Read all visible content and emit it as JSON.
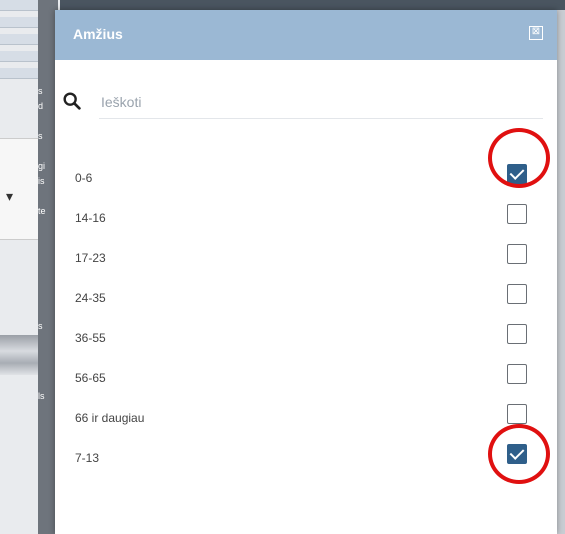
{
  "dialog": {
    "title": "Amžius",
    "search_placeholder": "Ieškoti"
  },
  "options": [
    {
      "label": "0-6",
      "checked": true
    },
    {
      "label": "14-16",
      "checked": false
    },
    {
      "label": "17-23",
      "checked": false
    },
    {
      "label": "24-35",
      "checked": false
    },
    {
      "label": "36-55",
      "checked": false
    },
    {
      "label": "56-65",
      "checked": false
    },
    {
      "label": "66 ir daugiau",
      "checked": false
    },
    {
      "label": "7-13",
      "checked": true
    }
  ],
  "background": {
    "side_texts": [
      "s",
      "d",
      "s",
      "gi",
      "is",
      "te",
      "s",
      "ls"
    ]
  },
  "colors": {
    "header": "#9bb8d4",
    "checked": "#2f5f8a",
    "annotation": "#e01010"
  }
}
